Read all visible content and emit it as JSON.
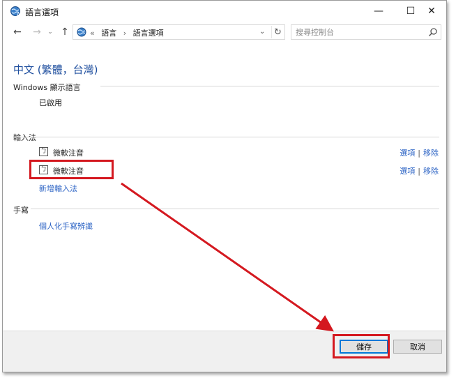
{
  "window": {
    "title": "語言選項",
    "min_glyph": "—",
    "max_glyph": "☐",
    "close_glyph": "✕"
  },
  "nav": {
    "back_glyph": "←",
    "forward_glyph": "→",
    "recent_glyph": "⌄",
    "up_glyph": "↑",
    "breadcrumb": {
      "overflow": "«",
      "item1": "語言",
      "sep": "›",
      "item2": "語言選項"
    },
    "dropdown_glyph": "⌄",
    "refresh_glyph": "↻"
  },
  "search": {
    "placeholder": "搜尋控制台"
  },
  "content": {
    "title": "中文 (繁體，台灣)",
    "display_language": {
      "heading": "Windows 顯示語言",
      "status": "已啟用"
    },
    "input_methods": {
      "heading": "輸入法",
      "items": [
        {
          "icon_glyph": "ㄅ",
          "name": "微軟注音",
          "options": "選項",
          "divider": "|",
          "remove": "移除"
        },
        {
          "icon_glyph": "ㄅ",
          "name": "微軟注音",
          "options": "選項",
          "divider": "|",
          "remove": "移除"
        }
      ],
      "add_link": "新增輸入法"
    },
    "handwriting": {
      "heading": "手寫",
      "link": "個人化手寫辨識"
    }
  },
  "footer": {
    "save_label": "儲存",
    "cancel_label": "取消"
  },
  "colors": {
    "link": "#2a62c4",
    "title": "#1e4e9e",
    "annotation": "#d4181f",
    "default_button_border": "#0078d7"
  }
}
